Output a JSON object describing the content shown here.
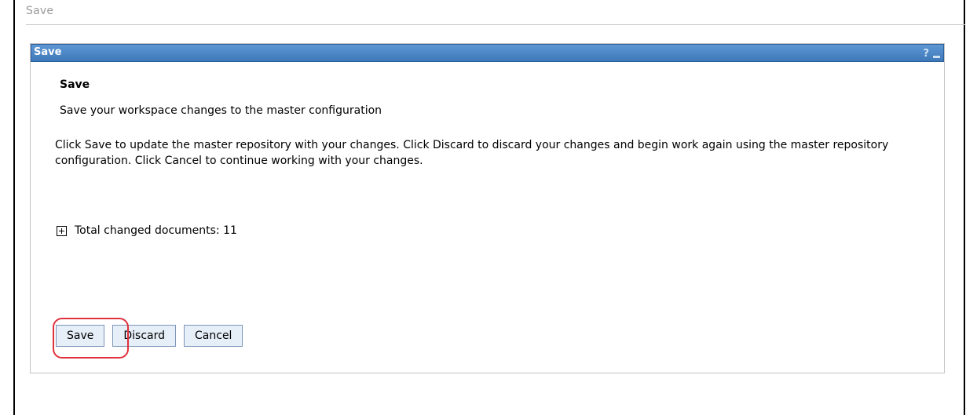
{
  "page": {
    "title": "Save"
  },
  "portlet": {
    "title": "Save",
    "help_label": "?",
    "minimize_label": "minimize"
  },
  "content": {
    "heading": "Save",
    "subtitle": "Save your workspace changes to the master configuration",
    "description": "Click Save to update the master repository with your changes. Click Discard to discard your changes and begin work again using the master repository configuration. Click Cancel to continue working with your changes.",
    "changed_documents": "Total changed documents: 11"
  },
  "buttons": {
    "save_label": "Save",
    "discard_label": "Discard",
    "cancel_label": "Cancel"
  },
  "icons": {
    "expand": "plus-box-icon",
    "help": "question-mark-icon",
    "minimize": "minimize-icon"
  },
  "colors": {
    "titlebar": "#4f8ac9",
    "button_bg": "#e6eef8",
    "highlight": "#e0313c"
  }
}
